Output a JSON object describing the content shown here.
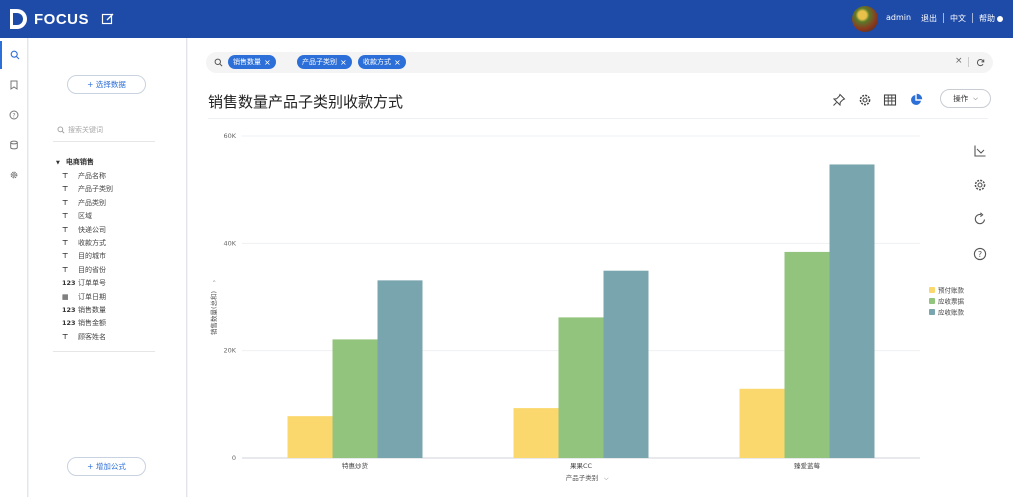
{
  "app": {
    "logo_text": "FOCUS"
  },
  "top": {
    "user": "admin",
    "logout": "退出",
    "lang": "中文",
    "help": "帮助"
  },
  "panel": {
    "select_data": "+ 选择数据",
    "search_placeholder": "搜索关键词",
    "root": "电商销售",
    "fields": [
      {
        "type": "T",
        "name": "产品名称"
      },
      {
        "type": "T",
        "name": "产品子类别"
      },
      {
        "type": "T",
        "name": "产品类别"
      },
      {
        "type": "T",
        "name": "区域"
      },
      {
        "type": "T",
        "name": "快递公司"
      },
      {
        "type": "T",
        "name": "收款方式"
      },
      {
        "type": "T",
        "name": "目的城市"
      },
      {
        "type": "T",
        "name": "目的省份"
      },
      {
        "type": "123",
        "name": "订单单号"
      },
      {
        "type": "date",
        "name": "订单日期"
      },
      {
        "type": "123",
        "name": "销售数量"
      },
      {
        "type": "123",
        "name": "销售金额"
      },
      {
        "type": "T",
        "name": "顾客姓名"
      }
    ],
    "add_formula": "+ 增加公式"
  },
  "search": {
    "chips": [
      {
        "label": "销售数量"
      },
      {
        "label": "产品子类别"
      },
      {
        "label": "收款方式"
      }
    ]
  },
  "main": {
    "title": "销售数量产品子类别收款方式",
    "operate": "操作"
  },
  "chart_data": {
    "type": "bar",
    "title": "",
    "xlabel": "产品子类别",
    "ylabel": "销售数量(总和)",
    "ylim": [
      0,
      60000
    ],
    "yticks": [
      "0",
      "20K",
      "40K",
      "60K"
    ],
    "categories": [
      "特惠炒货",
      "果果CC",
      "臻爱蓝莓"
    ],
    "legend_position": "right",
    "series": [
      {
        "name": "预付账款",
        "color": "#fbd86d",
        "values": [
          7800,
          9300,
          12900
        ]
      },
      {
        "name": "应收票据",
        "color": "#93c47d",
        "values": [
          22100,
          26200,
          38400
        ]
      },
      {
        "name": "应收账款",
        "color": "#79a6ae",
        "values": [
          33100,
          34900,
          54700
        ]
      }
    ]
  }
}
